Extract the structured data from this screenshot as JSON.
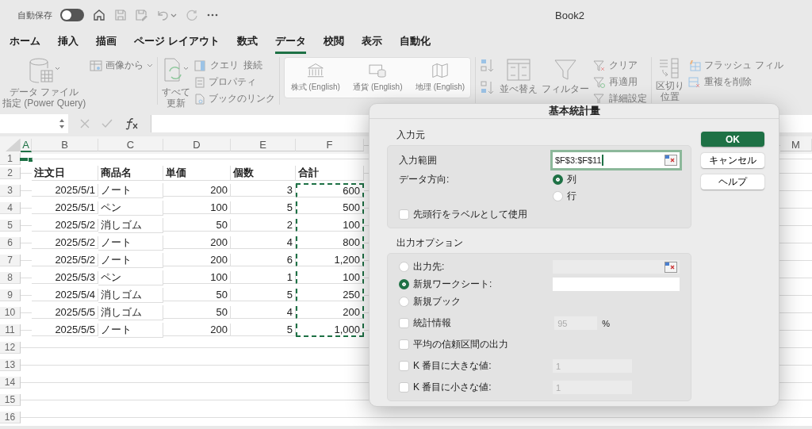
{
  "title_bar": {
    "autosave_label": "自動保存",
    "autosave_on": false,
    "title": "Book2"
  },
  "tabs": [
    {
      "label": "ホーム",
      "selected": false
    },
    {
      "label": "挿入",
      "selected": false
    },
    {
      "label": "描画",
      "selected": false
    },
    {
      "label": "ページ レイアウト",
      "selected": false
    },
    {
      "label": "数式",
      "selected": false
    },
    {
      "label": "データ",
      "selected": true
    },
    {
      "label": "校閲",
      "selected": false
    },
    {
      "label": "表示",
      "selected": false
    },
    {
      "label": "自動化",
      "selected": false
    }
  ],
  "ribbon": {
    "disabled": true,
    "get_data": [
      "データ ファイル",
      "指定 (Power Query)"
    ],
    "from_picture": "画像から",
    "refresh_all": [
      "すべて",
      "更新"
    ],
    "queries": "クエリ",
    "connections": "接続",
    "properties": "プロパティ",
    "workbook_links": "ブックのリンク",
    "data_types": [
      {
        "kind": "stocks",
        "label": "株式 (English)"
      },
      {
        "kind": "currency",
        "label": "通貨 (English)"
      },
      {
        "kind": "geography",
        "label": "地理 (English)"
      }
    ],
    "sort": "並べ替え",
    "filter": "フィルター",
    "clear": "クリア",
    "reapply": "再適用",
    "advanced": "詳細設定",
    "text_to_columns": [
      "区切り",
      "位置"
    ],
    "flash_fill": "フラッシュ フィル",
    "remove_duplicates": "重複を削除"
  },
  "sheet": {
    "columns": [
      {
        "label": "A",
        "selected": true
      },
      {
        "label": "B",
        "selected": false
      },
      {
        "label": "C",
        "selected": false
      },
      {
        "label": "D",
        "selected": false
      },
      {
        "label": "E",
        "selected": false
      },
      {
        "label": "F",
        "selected": false
      }
    ],
    "right_columns": [
      {
        "label": "M"
      }
    ],
    "rows": [
      {
        "header": "1",
        "active_a": true,
        "cells": []
      },
      {
        "header": "2",
        "heading": true,
        "cells": [
          "",
          "注文日",
          "商品名",
          "単価",
          "個数",
          "合計"
        ]
      },
      {
        "header": "3",
        "marquee": true,
        "cells": [
          "",
          "2025/5/1",
          "ノート",
          "200",
          "3",
          "600"
        ]
      },
      {
        "header": "4",
        "marquee": true,
        "cells": [
          "",
          "2025/5/1",
          "ペン",
          "100",
          "5",
          "500"
        ]
      },
      {
        "header": "5",
        "marquee": true,
        "cells": [
          "",
          "2025/5/2",
          "消しゴム",
          "50",
          "2",
          "100"
        ]
      },
      {
        "header": "6",
        "marquee": true,
        "cells": [
          "",
          "2025/5/2",
          "ノート",
          "200",
          "4",
          "800"
        ]
      },
      {
        "header": "7",
        "marquee": true,
        "cells": [
          "",
          "2025/5/2",
          "ノート",
          "200",
          "6",
          "1,200"
        ]
      },
      {
        "header": "8",
        "marquee": true,
        "cells": [
          "",
          "2025/5/3",
          "ペン",
          "100",
          "1",
          "100"
        ]
      },
      {
        "header": "9",
        "marquee": true,
        "cells": [
          "",
          "2025/5/4",
          "消しゴム",
          "50",
          "5",
          "250"
        ]
      },
      {
        "header": "10",
        "marquee": true,
        "cells": [
          "",
          "2025/5/5",
          "消しゴム",
          "50",
          "4",
          "200"
        ]
      },
      {
        "header": "11",
        "marquee": true,
        "cells": [
          "",
          "2025/5/5",
          "ノート",
          "200",
          "5",
          "1,000"
        ]
      },
      {
        "header": "12",
        "cells": []
      },
      {
        "header": "13",
        "cells": []
      },
      {
        "header": "14",
        "cells": []
      },
      {
        "header": "15",
        "cells": []
      },
      {
        "header": "16",
        "cells": []
      }
    ]
  },
  "dialog": {
    "title": "基本統計量",
    "input": {
      "heading": "入力元",
      "range_label": "入力範囲",
      "range_value": "$F$3:$F$11",
      "direction_label": "データ方向:",
      "directions": [
        {
          "label": "列",
          "selected": true
        },
        {
          "label": "行",
          "selected": false
        }
      ],
      "labels_in_first_row": {
        "label": "先頭行をラベルとして使用",
        "checked": false
      }
    },
    "output": {
      "heading": "出力オプション",
      "options": [
        {
          "kind": "radio",
          "label": "出力先:",
          "selected": false,
          "field": {
            "disabled": true,
            "ref_button": true
          }
        },
        {
          "kind": "radio",
          "label": "新規ワークシート:",
          "selected": true,
          "field": {
            "disabled": false,
            "ref_button": false
          }
        },
        {
          "kind": "radio",
          "label": "新規ブック",
          "selected": false
        },
        {
          "kind": "checkbox",
          "label": "統計情報",
          "checked": false,
          "field": {
            "value": "95",
            "disabled": true,
            "ref_button": false
          },
          "suffix": "%"
        },
        {
          "kind": "checkbox",
          "label": "平均の信頼区間の出力",
          "checked": false
        },
        {
          "kind": "checkbox",
          "label": "K 番目に大きな値:",
          "checked": false,
          "field": {
            "value": "1",
            "disabled": true,
            "ref_button": false
          }
        },
        {
          "kind": "checkbox",
          "label": "K 番目に小さな値:",
          "checked": false,
          "field": {
            "value": "1",
            "disabled": true,
            "ref_button": false
          }
        }
      ]
    },
    "buttons": [
      {
        "label": "OK",
        "primary": true
      },
      {
        "label": "キャンセル",
        "primary": false
      },
      {
        "label": "ヘルプ",
        "primary": false
      }
    ]
  }
}
